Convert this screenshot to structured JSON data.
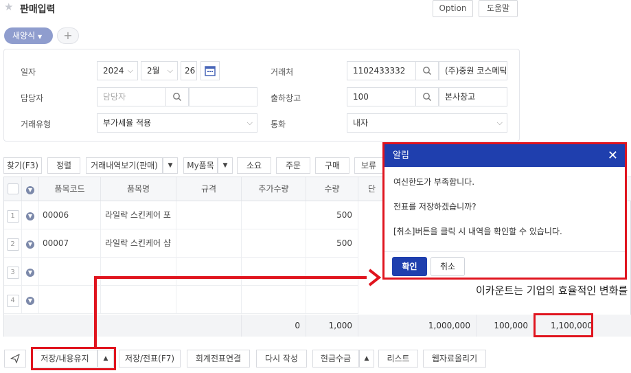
{
  "header": {
    "title": "판매입력",
    "option_label": "Option",
    "help_label": "도움말"
  },
  "tabs": {
    "active_label": "새양식",
    "add_label": "+"
  },
  "form": {
    "date_label": "일자",
    "year_value": "2024",
    "month_value": "2월",
    "day_value": "26",
    "staff_label": "담당자",
    "staff_placeholder": "담당자",
    "trade_type_label": "거래유형",
    "trade_type_value": "부가세율 적용",
    "customer_label": "거래처",
    "customer_code": "1102433332",
    "customer_name": "(주)중원 코스메틱",
    "warehouse_label": "출하창고",
    "warehouse_code": "100",
    "warehouse_name": "본사창고",
    "currency_label": "통화",
    "currency_value": "내자"
  },
  "toolbar": {
    "find_label": "찾기(F3)",
    "sort_label": "정렬",
    "history_label": "거래내역보기(판매)",
    "my_items_label": "My품목",
    "consume_label": "소요",
    "order_label": "주문",
    "purchase_label": "구매",
    "extra_label": "보류"
  },
  "grid": {
    "columns": [
      "품목코드",
      "품목명",
      "규격",
      "추가수량",
      "수량",
      "단"
    ],
    "rows": [
      {
        "num": "1",
        "code": "00006",
        "name": "라일락 스킨케어 포",
        "qty": "500"
      },
      {
        "num": "2",
        "code": "00007",
        "name": "라일락 스킨케어 샴",
        "qty": "500"
      },
      {
        "num": "3",
        "code": "",
        "name": "",
        "qty": ""
      },
      {
        "num": "4",
        "code": "",
        "name": "",
        "qty": ""
      }
    ],
    "sum": {
      "extra_qty": "0",
      "qty": "1,000",
      "supply": "1,000,000",
      "vat": "100,000",
      "total": "1,100,000"
    }
  },
  "bottom": {
    "save_keep_label": "저장/내용유지",
    "save_slip_label": "저장/전표(F7)",
    "account_link_label": "회계전표연결",
    "rewrite_label": "다시 작성",
    "cash_label": "현금수금",
    "list_label": "리스트",
    "web_upload_label": "웹자료올리기"
  },
  "modal": {
    "title": "알림",
    "line1": "여신한도가 부족합니다.",
    "line2": "전표를 저장하겠습니까?",
    "line3": "[취소]버튼을 클릭 시 내역을 확인할 수 있습니다.",
    "ok_label": "확인",
    "cancel_label": "취소"
  },
  "overlay_caption": "이카운트는 기업의 효율적인 변화를",
  "colors": {
    "modal_header": "#1f3fae",
    "highlight_red": "#e0141e",
    "tab_active": "#8f9dce"
  }
}
